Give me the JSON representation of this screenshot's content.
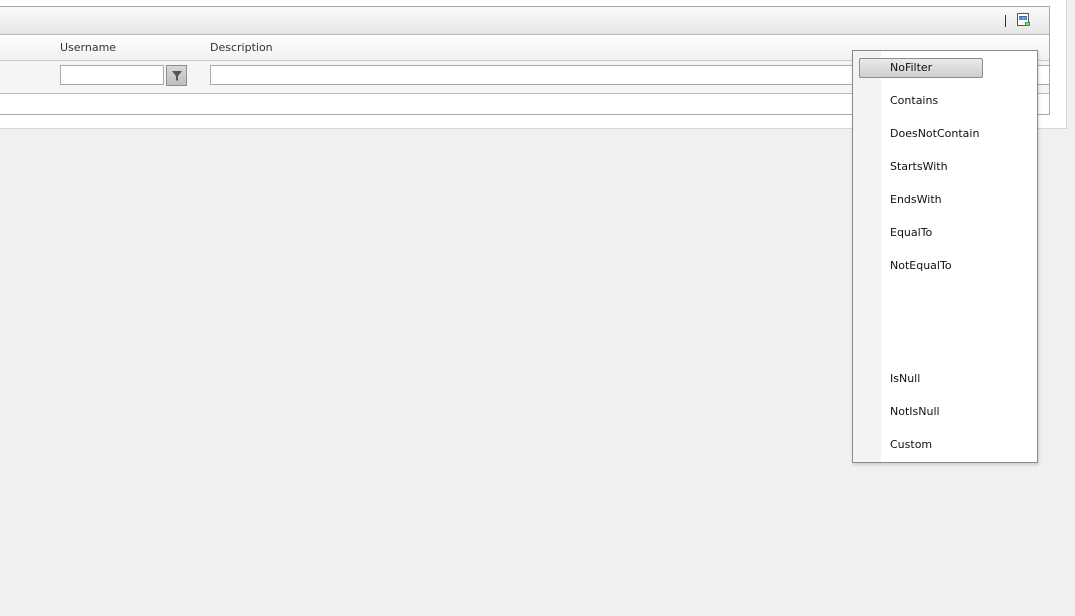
{
  "grid": {
    "columns": [
      {
        "header": "Username",
        "filter_value": "",
        "filter_button": "filter"
      },
      {
        "header": "Description",
        "filter_value": ""
      }
    ],
    "commandbar": {
      "export_icon": "csv-export-icon"
    }
  },
  "filter_menu": {
    "selected": "NoFilter",
    "items": [
      "NoFilter",
      "Contains",
      "DoesNotContain",
      "StartsWith",
      "EndsWith",
      "EqualTo",
      "NotEqualTo",
      "IsNull",
      "NotIsNull",
      "Custom"
    ]
  }
}
